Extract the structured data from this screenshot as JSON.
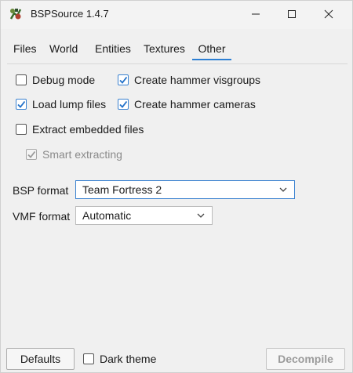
{
  "window": {
    "title": "BSPSource 1.4.7"
  },
  "icons": {
    "app": "bspsource-app-icon",
    "minimize": "minimize-icon",
    "maximize": "maximize-icon",
    "close": "close-icon",
    "check": "checkmark-icon",
    "chevron": "chevron-down-icon"
  },
  "tabs": [
    {
      "label": "Files"
    },
    {
      "label": "World"
    },
    {
      "label": "Entities"
    },
    {
      "label": "Textures"
    },
    {
      "label": "Other",
      "active": true
    }
  ],
  "options": {
    "debug_mode": {
      "label": "Debug mode",
      "checked": false
    },
    "create_hammer_visgroups": {
      "label": "Create hammer visgroups",
      "checked": true
    },
    "load_lump_files": {
      "label": "Load lump files",
      "checked": true
    },
    "create_hammer_cameras": {
      "label": "Create hammer cameras",
      "checked": true
    },
    "extract_embedded_files": {
      "label": "Extract embedded files",
      "checked": false
    },
    "smart_extracting": {
      "label": "Smart extracting",
      "checked": true,
      "disabled": true
    }
  },
  "bsp_format": {
    "label": "BSP format",
    "value": "Team Fortress 2"
  },
  "vmf_format": {
    "label": "VMF format",
    "value": "Automatic"
  },
  "footer": {
    "defaults_label": "Defaults",
    "dark_theme_label": "Dark theme",
    "dark_theme_checked": false,
    "decompile_label": "Decompile",
    "decompile_disabled": true
  },
  "colors": {
    "accent": "#2d7fd3",
    "window_bg": "#f0f0f0",
    "disabled_text": "#9b9b9b"
  }
}
